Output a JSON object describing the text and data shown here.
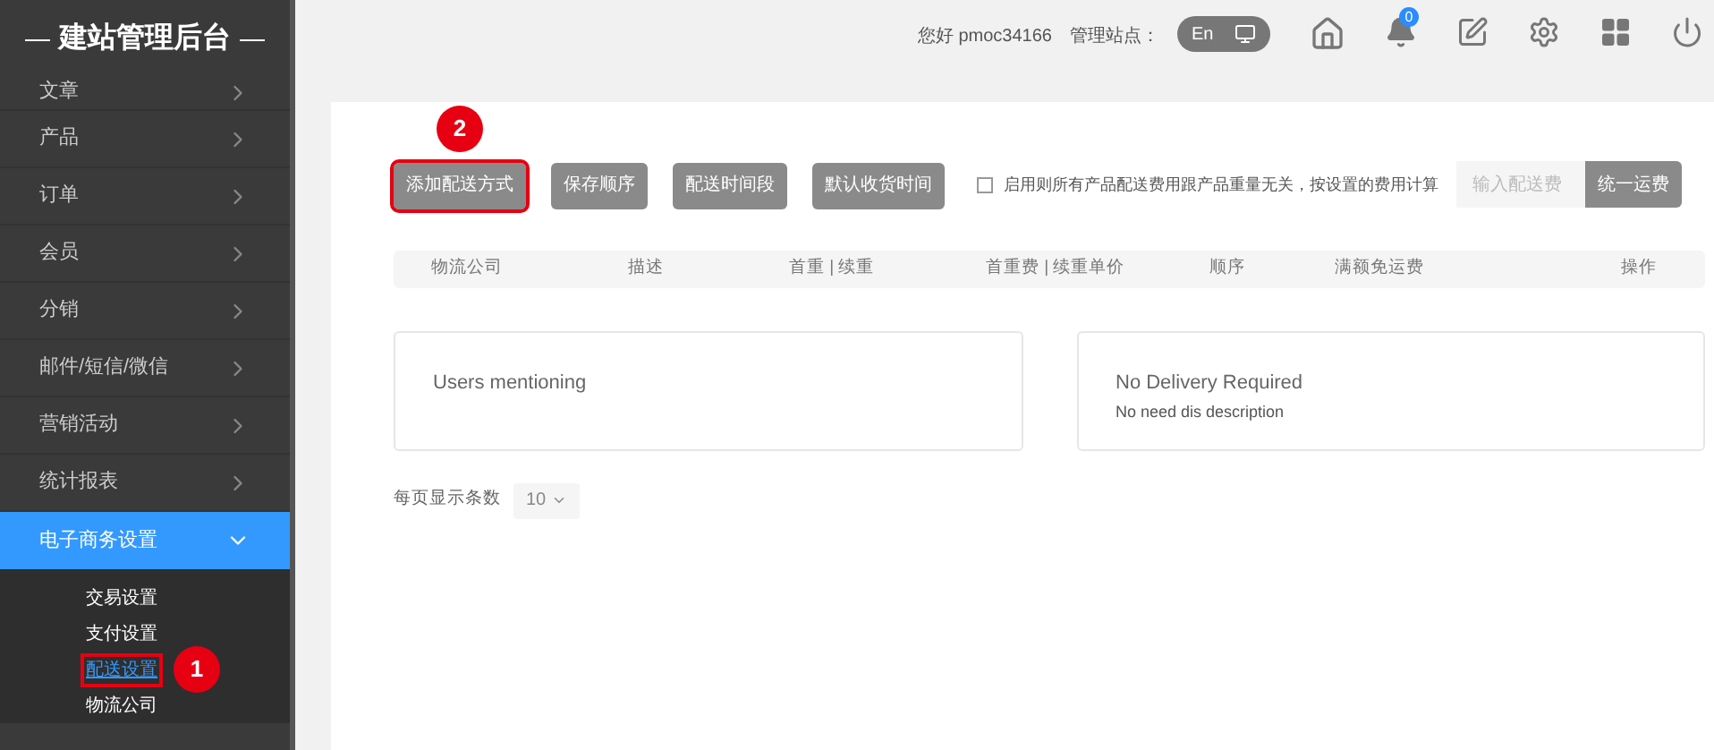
{
  "sidebar": {
    "title": "建站管理后台",
    "items": [
      {
        "label": "文章",
        "expanded": false,
        "selected": false
      },
      {
        "label": "产品",
        "expanded": false,
        "selected": false
      },
      {
        "label": "订单",
        "expanded": false,
        "selected": false
      },
      {
        "label": "会员",
        "expanded": false,
        "selected": false
      },
      {
        "label": "分销",
        "expanded": false,
        "selected": false
      },
      {
        "label": "邮件/短信/微信",
        "expanded": false,
        "selected": false
      },
      {
        "label": "营销活动",
        "expanded": false,
        "selected": false
      },
      {
        "label": "统计报表",
        "expanded": false,
        "selected": false
      },
      {
        "label": "电子商务设置",
        "expanded": true,
        "selected": true,
        "children": [
          {
            "label": "交易设置",
            "selected": false
          },
          {
            "label": "支付设置",
            "selected": false
          },
          {
            "label": "配送设置",
            "selected": true,
            "annotation": "1"
          },
          {
            "label": "物流公司",
            "selected": false
          }
        ]
      }
    ]
  },
  "header": {
    "greeting": "您好 pmoc34166",
    "site_label": "管理站点：",
    "language": "En",
    "notification_count": "0"
  },
  "toolbar": {
    "buttons": [
      {
        "label": "添加配送方式",
        "annotation": "2"
      },
      {
        "label": "保存顺序"
      },
      {
        "label": "配送时间段"
      },
      {
        "label": "默认收货时间"
      }
    ],
    "checkbox": {
      "label": "启用则所有产品配送费用跟产品重量无关，按设置的费用计算",
      "checked": false
    },
    "fee_input": {
      "placeholder": "输入配送费"
    },
    "fee_button": "统一运费"
  },
  "table": {
    "columns": [
      "物流公司",
      "描述",
      "首重 | 续重",
      "首重费 | 续重单价",
      "顺序",
      "满额免运费",
      "操作"
    ]
  },
  "cards": [
    {
      "title": "Users mentioning"
    },
    {
      "title": "No Delivery Required",
      "description": "No need dis description"
    }
  ],
  "pagination": {
    "label": "每页显示条数",
    "page_size": "10"
  }
}
